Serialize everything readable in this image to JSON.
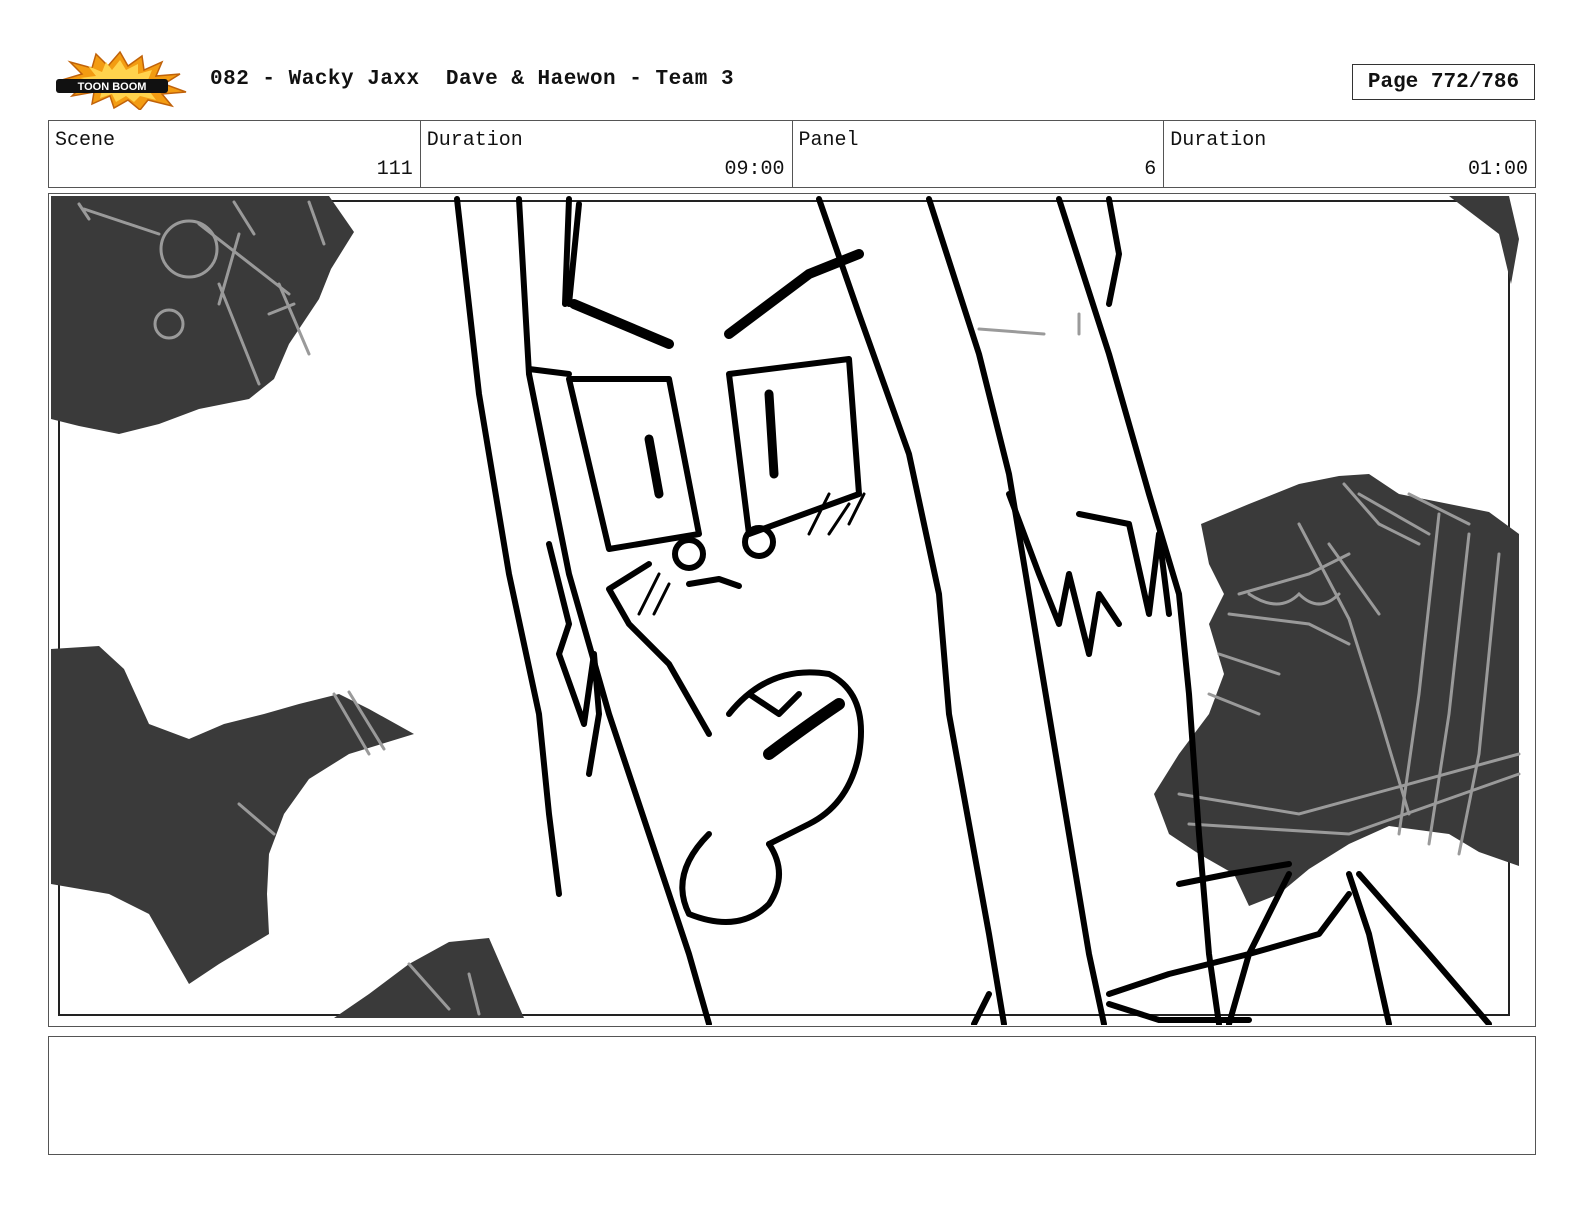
{
  "header": {
    "logo_text": "TOON BOOM",
    "title": "082 - Wacky Jaxx  Dave & Haewon - Team 3",
    "page": "Page 772/786"
  },
  "info": {
    "scene_label": "Scene",
    "scene_value": "111",
    "scene_duration_label": "Duration",
    "scene_duration_value": "09:00",
    "panel_label": "Panel",
    "panel_value": "6",
    "panel_duration_label": "Duration",
    "panel_duration_value": "01:00"
  },
  "notes": {
    "text": ""
  },
  "colors": {
    "shadow": "#3a3a3a",
    "ink": "#000000",
    "pencil": "#9a9a9a",
    "logo_orange": "#f39c12"
  }
}
